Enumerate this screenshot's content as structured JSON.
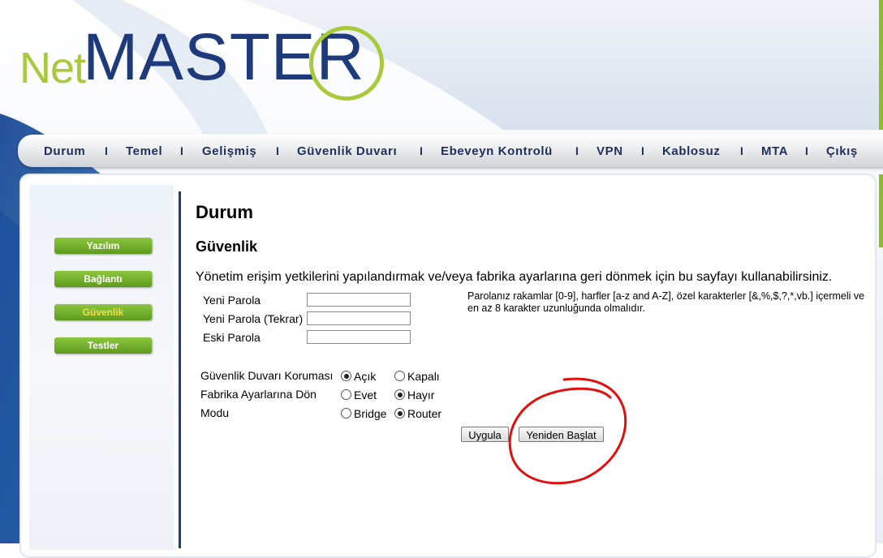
{
  "brand": {
    "logo_net": "Net",
    "logo_master": "MASTE",
    "logo_r": "R"
  },
  "nav": {
    "items": [
      "Durum",
      "Temel",
      "Gelişmiş",
      "Güvenlik Duvarı",
      "Ebeveyn Kontrolü",
      "VPN",
      "Kablosuz",
      "MTA",
      "Çıkış"
    ],
    "separator": "I"
  },
  "sidebar": {
    "items": [
      {
        "label": "Yazılım",
        "active": false
      },
      {
        "label": "Bağlantı",
        "active": false
      },
      {
        "label": "Güvenlik",
        "active": true
      },
      {
        "label": "Testler",
        "active": false
      }
    ]
  },
  "page": {
    "title": "Durum",
    "section": "Güvenlik",
    "description": "Yönetim erişim yetkilerini yapılandırmak ve/veya fabrika ayarlarına geri dönmek için bu sayfayı kullanabilirsiniz."
  },
  "password": {
    "new_label": "Yeni Parola",
    "new_repeat_label": "Yeni Parola (Tekrar)",
    "old_label": "Eski Parola",
    "new_value": "",
    "new_repeat_value": "",
    "old_value": "",
    "hint": "Parolanız rakamlar [0-9], harfler [a-z and A-Z], özel karakterler [&,%,$,?,*,vb.] içermeli ve en az 8 karakter uzunluğunda olmalıdır."
  },
  "options": {
    "firewall": {
      "label": "Güvenlik Duvarı Koruması",
      "on": "Açık",
      "off": "Kapalı",
      "selected": "Açık"
    },
    "factory": {
      "label": "Fabrika Ayarlarına Dön",
      "yes": "Evet",
      "no": "Hayır",
      "selected": "Hayır"
    },
    "mode": {
      "label": "Modu",
      "bridge": "Bridge",
      "router": "Router",
      "selected": "Router"
    }
  },
  "buttons": {
    "apply": "Uygula",
    "restart": "Yeniden Başlat"
  },
  "colors": {
    "accent_green": "#8cc63f",
    "brand_blue": "#1f3a7a",
    "annotation_red": "#e01010"
  }
}
